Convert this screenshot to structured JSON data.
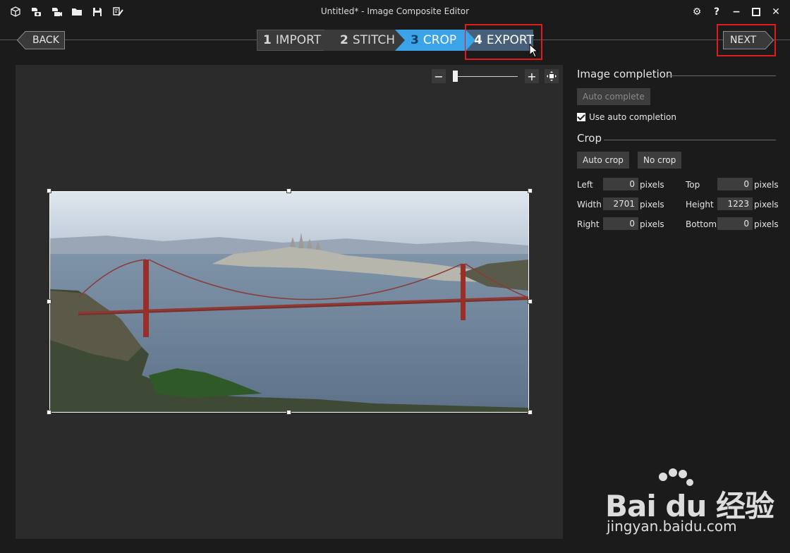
{
  "window": {
    "title": "Untitled* - Image Composite Editor",
    "controls": {
      "settings": "⚙",
      "help": "?",
      "minimize": "−",
      "maximize": "□",
      "close": "✕"
    }
  },
  "toolbar_icons": [
    "new-project-icon",
    "new-panorama-from-images-icon",
    "new-panorama-from-video-icon",
    "open-icon",
    "save-icon",
    "save-as-icon"
  ],
  "nav": {
    "back_label": "BACK",
    "next_label": "NEXT",
    "steps": [
      {
        "number": "1",
        "label": "IMPORT"
      },
      {
        "number": "2",
        "label": "STITCH"
      },
      {
        "number": "3",
        "label": "CROP"
      },
      {
        "number": "4",
        "label": "EXPORT"
      }
    ],
    "active_step": 3
  },
  "zoom": {
    "minus": "−",
    "plus": "+",
    "level": 0.0
  },
  "panel": {
    "image_completion": {
      "title": "Image completion",
      "auto_complete_label": "Auto complete",
      "use_auto_label": "Use auto completion",
      "use_auto_checked": true
    },
    "crop": {
      "title": "Crop",
      "auto_crop_label": "Auto crop",
      "no_crop_label": "No crop",
      "fields": {
        "left": {
          "label": "Left",
          "value": "0",
          "unit": "pixels"
        },
        "top": {
          "label": "Top",
          "value": "0",
          "unit": "pixels"
        },
        "width": {
          "label": "Width",
          "value": "2701",
          "unit": "pixels"
        },
        "height": {
          "label": "Height",
          "value": "1223",
          "unit": "pixels"
        },
        "right": {
          "label": "Right",
          "value": "0",
          "unit": "pixels"
        },
        "bottom": {
          "label": "Bottom",
          "value": "0",
          "unit": "pixels"
        }
      }
    }
  },
  "watermark": {
    "brand": "Bai du 经验",
    "url": "jingyan.baidu.com"
  },
  "colors": {
    "accent": "#3ba3e8",
    "highlight": "#e01b1b",
    "background": "#1b1b1b",
    "canvas": "#2b2b2b"
  }
}
